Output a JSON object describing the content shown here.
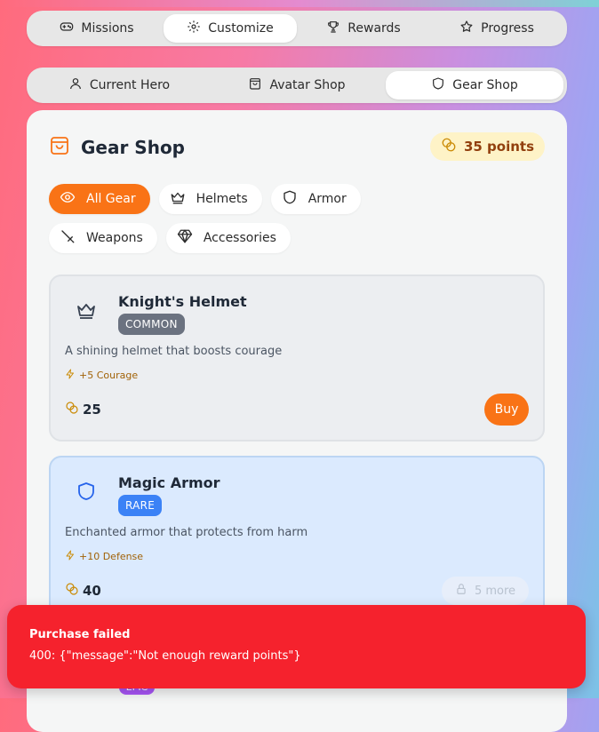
{
  "main_tabs": [
    {
      "label": "Missions",
      "icon": "gamepad-icon",
      "active": false
    },
    {
      "label": "Customize",
      "icon": "gear-icon",
      "active": true
    },
    {
      "label": "Rewards",
      "icon": "trophy-icon",
      "active": false
    },
    {
      "label": "Progress",
      "icon": "star-icon",
      "active": false
    }
  ],
  "sub_tabs": [
    {
      "label": "Current Hero",
      "icon": "user-icon",
      "active": false
    },
    {
      "label": "Avatar Shop",
      "icon": "shopping-bag-icon",
      "active": false
    },
    {
      "label": "Gear Shop",
      "icon": "shield-icon",
      "active": true
    }
  ],
  "shop": {
    "title": "Gear Shop",
    "points": "35 points"
  },
  "filters": [
    {
      "label": "All Gear",
      "icon": "eye-icon",
      "active": true
    },
    {
      "label": "Helmets",
      "icon": "crown-icon",
      "active": false
    },
    {
      "label": "Armor",
      "icon": "shield-icon",
      "active": false
    },
    {
      "label": "Weapons",
      "icon": "sword-icon",
      "active": false
    },
    {
      "label": "Accessories",
      "icon": "gem-icon",
      "active": false
    }
  ],
  "items": [
    {
      "name": "Knight's Helmet",
      "rarity": "COMMON",
      "description": "A shining helmet that boosts courage",
      "stat": "+5 Courage",
      "price": "25",
      "action": "Buy"
    },
    {
      "name": "Magic Armor",
      "rarity": "RARE",
      "description": "Enchanted armor that protects from harm",
      "stat": "+10 Defense",
      "price": "40",
      "action": "5 more"
    }
  ],
  "toast": {
    "title": "Purchase failed",
    "message": "400: {\"message\":\"Not enough reward points\"}"
  },
  "peek_badge": "EPIC",
  "colors": {
    "accent": "#f97316",
    "error": "#f5222d",
    "rare": "#3b82f6",
    "common": "#6b7280",
    "epic": "#a855f7"
  }
}
